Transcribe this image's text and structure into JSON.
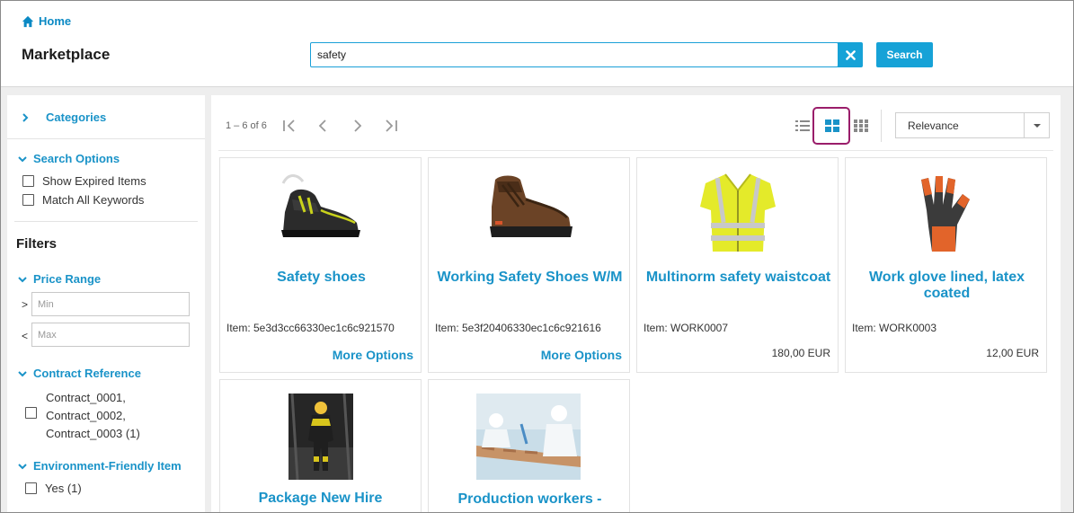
{
  "header": {
    "home_label": "Home",
    "title": "Marketplace",
    "search_value": "safety",
    "search_button": "Search"
  },
  "sidebar": {
    "categories": "Categories",
    "search_options": {
      "title": "Search Options",
      "options": [
        "Show Expired Items",
        "Match All Keywords"
      ]
    },
    "filters_title": "Filters",
    "price_range": {
      "title": "Price Range",
      "min_prefix": ">",
      "min_placeholder": "Min",
      "max_prefix": "<",
      "max_placeholder": "Max"
    },
    "contract_reference": {
      "title": "Contract Reference",
      "option_lines": [
        "Contract_0001,",
        "Contract_0002,",
        "Contract_0003 (1)"
      ]
    },
    "environment_friendly": {
      "title": "Environment-Friendly Item",
      "option": "Yes (1)"
    }
  },
  "toolbar": {
    "range_text": "1 – 6 of 6",
    "sort_selected": "Relevance",
    "view_modes": [
      "list-view-icon",
      "grid-view-icon",
      "compact-grid-view-icon"
    ],
    "active_view": "grid-view-icon"
  },
  "products": [
    {
      "title": "Safety shoes",
      "item": "Item: 5e3d3cc66330ec1c6c921570",
      "more": "More Options",
      "image": "black-safety-shoe"
    },
    {
      "title": "Working Safety Shoes W/M",
      "item": "Item: 5e3f20406330ec1c6c921616",
      "more": "More Options",
      "image": "brown-work-boot"
    },
    {
      "title": "Multinorm safety waistcoat",
      "item": "Item: WORK0007",
      "price": "180,00 EUR",
      "image": "yellow-hi-vis-vest"
    },
    {
      "title": "Work glove lined, latex coated",
      "item": "Item: WORK0003",
      "price": "12,00 EUR",
      "image": "orange-black-glove"
    },
    {
      "title": "Package New Hire",
      "image": "worker-photo"
    },
    {
      "title": "Production workers -",
      "image": "production-line-photo"
    }
  ],
  "colors": {
    "accent": "#1a93c8",
    "button": "#16a2d7",
    "highlight": "#9a1d6a"
  }
}
